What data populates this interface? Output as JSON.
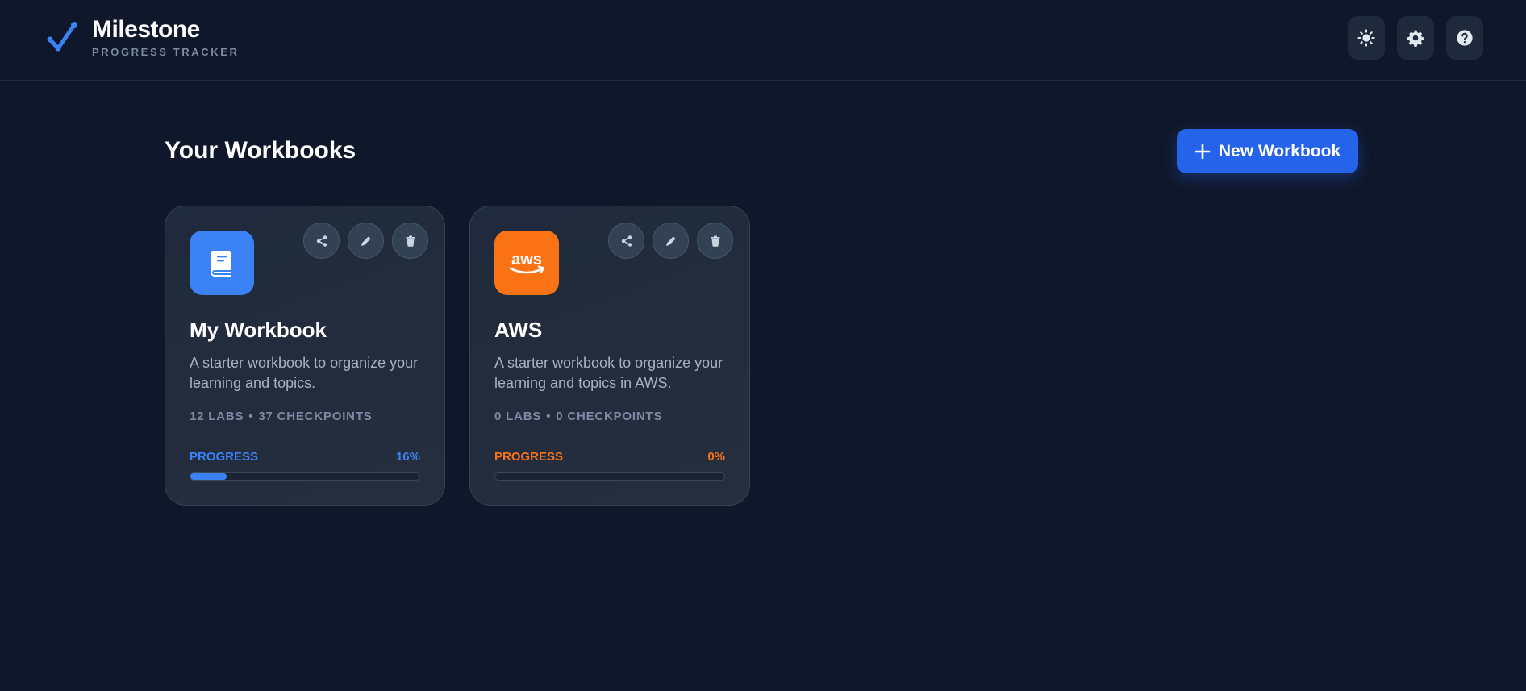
{
  "header": {
    "title": "Milestone",
    "subtitle": "PROGRESS TRACKER",
    "actions": [
      {
        "icon": "sun-icon"
      },
      {
        "icon": "gear-icon"
      },
      {
        "icon": "help-icon"
      }
    ]
  },
  "main": {
    "title": "Your Workbooks",
    "new_button_label": "New Workbook"
  },
  "workbooks": [
    {
      "icon": "book-icon",
      "color": "#3b82f6",
      "title": "My Workbook",
      "description": "A starter workbook to organize your learning and topics.",
      "labs": "12 LABS",
      "checkpoints": "37 CHECKPOINTS",
      "progress_label": "PROGRESS",
      "progress_text": "16%",
      "progress": 16
    },
    {
      "icon": "aws-icon",
      "color": "#f97316",
      "title": "AWS",
      "description": "A starter workbook to organize your learning and topics in AWS.",
      "labs": "0 LABS",
      "checkpoints": "0 CHECKPOINTS",
      "progress_label": "PROGRESS",
      "progress_text": "0%",
      "progress": 0
    }
  ],
  "meta_separator": "•",
  "colors": {
    "background": "#0f172a",
    "accent": "#2563eb",
    "blue": "#3b82f6",
    "orange": "#f97316"
  }
}
